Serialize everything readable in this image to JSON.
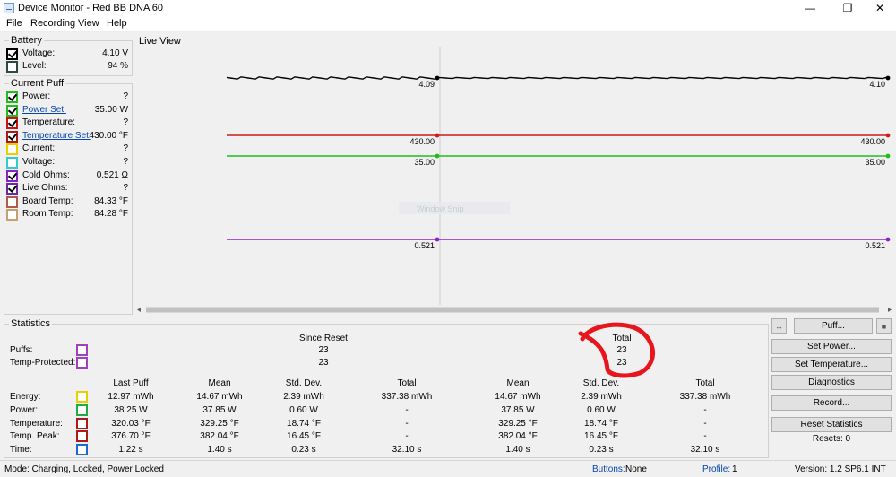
{
  "window": {
    "title": "Device Monitor - Red BB DNA 60"
  },
  "menu": [
    "File",
    "Recording",
    "View",
    "Help"
  ],
  "battery": {
    "title": "Battery",
    "rows": [
      {
        "label": "Voltage:",
        "value": "4.10 V",
        "color": "#000000",
        "checked": true,
        "link": false
      },
      {
        "label": "Level:",
        "value": "94 %",
        "color": "#2d4a3e",
        "checked": false,
        "link": false
      }
    ]
  },
  "puff": {
    "title": "Current Puff",
    "rows": [
      {
        "label": "Power:",
        "value": "?",
        "color": "#22bb22",
        "checked": true,
        "link": false
      },
      {
        "label": "Power Set:",
        "value": "35.00 W",
        "color": "#22bb22",
        "checked": true,
        "link": true
      },
      {
        "label": "Temperature:",
        "value": "?",
        "color": "#cc1111",
        "checked": true,
        "link": false
      },
      {
        "label": "Temperature Set:",
        "value": "430.00 °F",
        "color": "#aa1a1a",
        "checked": true,
        "link": true
      },
      {
        "label": "Current:",
        "value": "?",
        "color": "#e6d000",
        "checked": false,
        "link": false
      },
      {
        "label": "Voltage:",
        "value": "?",
        "color": "#33cccc",
        "checked": false,
        "link": false
      },
      {
        "label": "Cold Ohms:",
        "value": "0.521 Ω",
        "color": "#8a22cc",
        "checked": true,
        "link": false
      },
      {
        "label": "Live Ohms:",
        "value": "?",
        "color": "#6a2aa0",
        "checked": true,
        "link": false
      },
      {
        "label": "Board Temp:",
        "value": "84.33 °F",
        "color": "#b05a4a",
        "checked": false,
        "link": false
      },
      {
        "label": "Room Temp:",
        "value": "84.28 °F",
        "color": "#c8a070",
        "checked": false,
        "link": false
      }
    ]
  },
  "live_view": {
    "title": "Live View",
    "watermark": "Window Snip",
    "series": [
      {
        "color": "#000000",
        "level": 0.115,
        "left_label": "4.09",
        "right_label": "4.10",
        "noisy": true
      },
      {
        "color": "#c81e1e",
        "level": 0.33,
        "left_label": "430.00",
        "right_label": "430.00",
        "noisy": false
      },
      {
        "color": "#22bb22",
        "level": 0.405,
        "left_label": "35.00",
        "right_label": "35.00",
        "noisy": false
      },
      {
        "color": "#8a22cc",
        "level": 0.715,
        "left_label": "0.521",
        "right_label": "0.521",
        "noisy": false
      }
    ]
  },
  "statistics": {
    "title": "Statistics",
    "since_reset": "Since Reset",
    "total_header": "Total",
    "counts": [
      {
        "label": "Puffs:",
        "color": "#a040c0",
        "since": "23",
        "total": "23"
      },
      {
        "label": "Temp-Protected:",
        "color": "#a040c0",
        "since": "23",
        "total": "23"
      }
    ],
    "columns": [
      "Last Puff",
      "Mean",
      "Std. Dev.",
      "Total",
      "Mean",
      "Std. Dev.",
      "Total"
    ],
    "rows": [
      {
        "label": "Energy:",
        "color": "#e6d000",
        "values": [
          "12.97 mWh",
          "14.67 mWh",
          "2.39 mWh",
          "337.38 mWh",
          "14.67 mWh",
          "2.39 mWh",
          "337.38 mWh"
        ]
      },
      {
        "label": "Power:",
        "color": "#22aa44",
        "values": [
          "38.25 W",
          "37.85 W",
          "0.60 W",
          "-",
          "37.85 W",
          "0.60 W",
          "-"
        ]
      },
      {
        "label": "Temperature:",
        "color": "#aa1a1a",
        "values": [
          "320.03 °F",
          "329.25 °F",
          "18.74 °F",
          "-",
          "329.25 °F",
          "18.74 °F",
          "-"
        ]
      },
      {
        "label": "Temp. Peak:",
        "color": "#aa1a1a",
        "values": [
          "376.70 °F",
          "382.04 °F",
          "16.45 °F",
          "-",
          "382.04 °F",
          "16.45 °F",
          "-"
        ]
      },
      {
        "label": "Time:",
        "color": "#1a6ad0",
        "values": [
          "1.22 s",
          "1.40 s",
          "0.23 s",
          "32.10 s",
          "1.40 s",
          "0.23 s",
          "32.10 s"
        ]
      }
    ]
  },
  "buttons": {
    "puff": "Puff...",
    "set_power": "Set Power...",
    "set_temperature": "Set Temperature...",
    "diagnostics": "Diagnostics",
    "record": "Record...",
    "reset_statistics": "Reset Statistics",
    "resets": "Resets: 0"
  },
  "statusbar": {
    "mode": "Mode: Charging, Locked, Power Locked",
    "buttons_label": "Buttons:",
    "buttons_value": "None",
    "profile_label": "Profile:",
    "profile_value": "1",
    "version": "Version: 1.2 SP6.1 INT"
  }
}
